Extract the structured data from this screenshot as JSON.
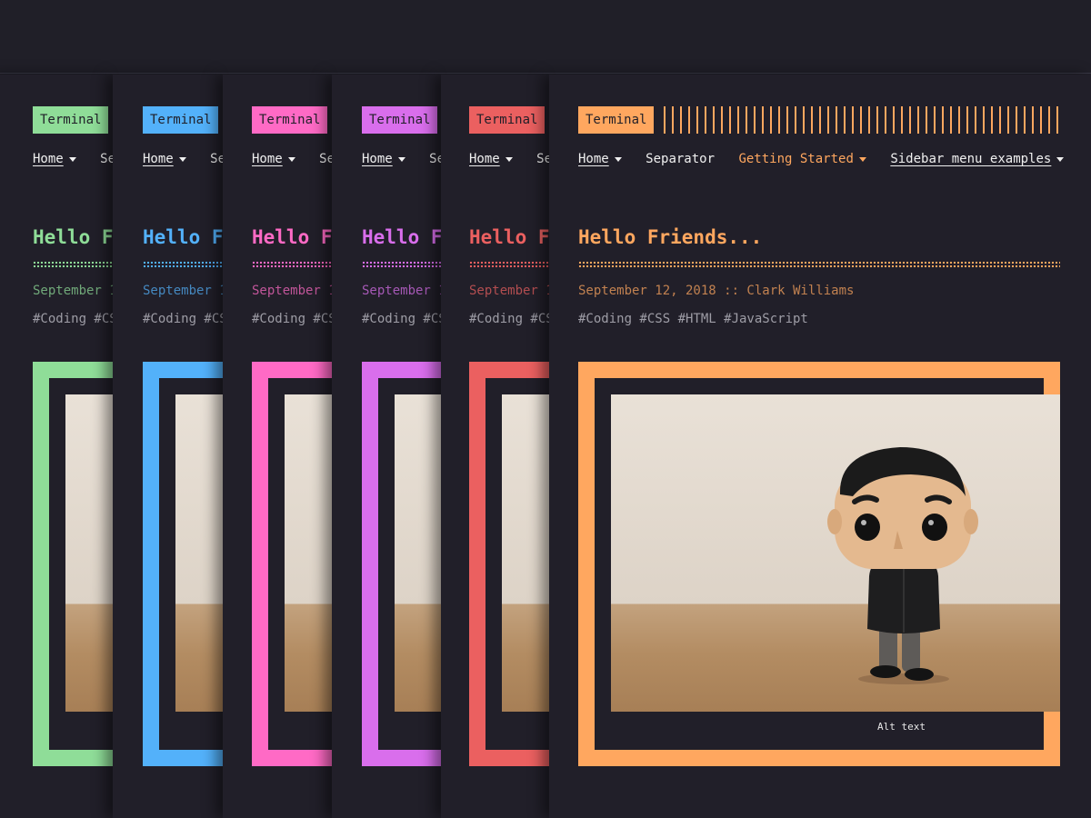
{
  "brand": "Terminal",
  "nav": {
    "home": "Home",
    "separator": "Separator",
    "getting_started": "Getting Started",
    "sidebar_menu": "Sidebar menu examples"
  },
  "post": {
    "title": "Hello Friends...",
    "meta": "September 12, 2018 :: Clark Williams",
    "tags": "#Coding #CSS #HTML #JavaScript",
    "image_caption": "Alt text"
  },
  "themes": [
    {
      "name": "green",
      "accent": "#8fdd98"
    },
    {
      "name": "blue",
      "accent": "#53b1fa"
    },
    {
      "name": "pink",
      "accent": "#ff6ac5"
    },
    {
      "name": "purple",
      "accent": "#d96eec"
    },
    {
      "name": "red",
      "accent": "#eb6060"
    },
    {
      "name": "orange",
      "accent": "#ffa75f"
    }
  ]
}
